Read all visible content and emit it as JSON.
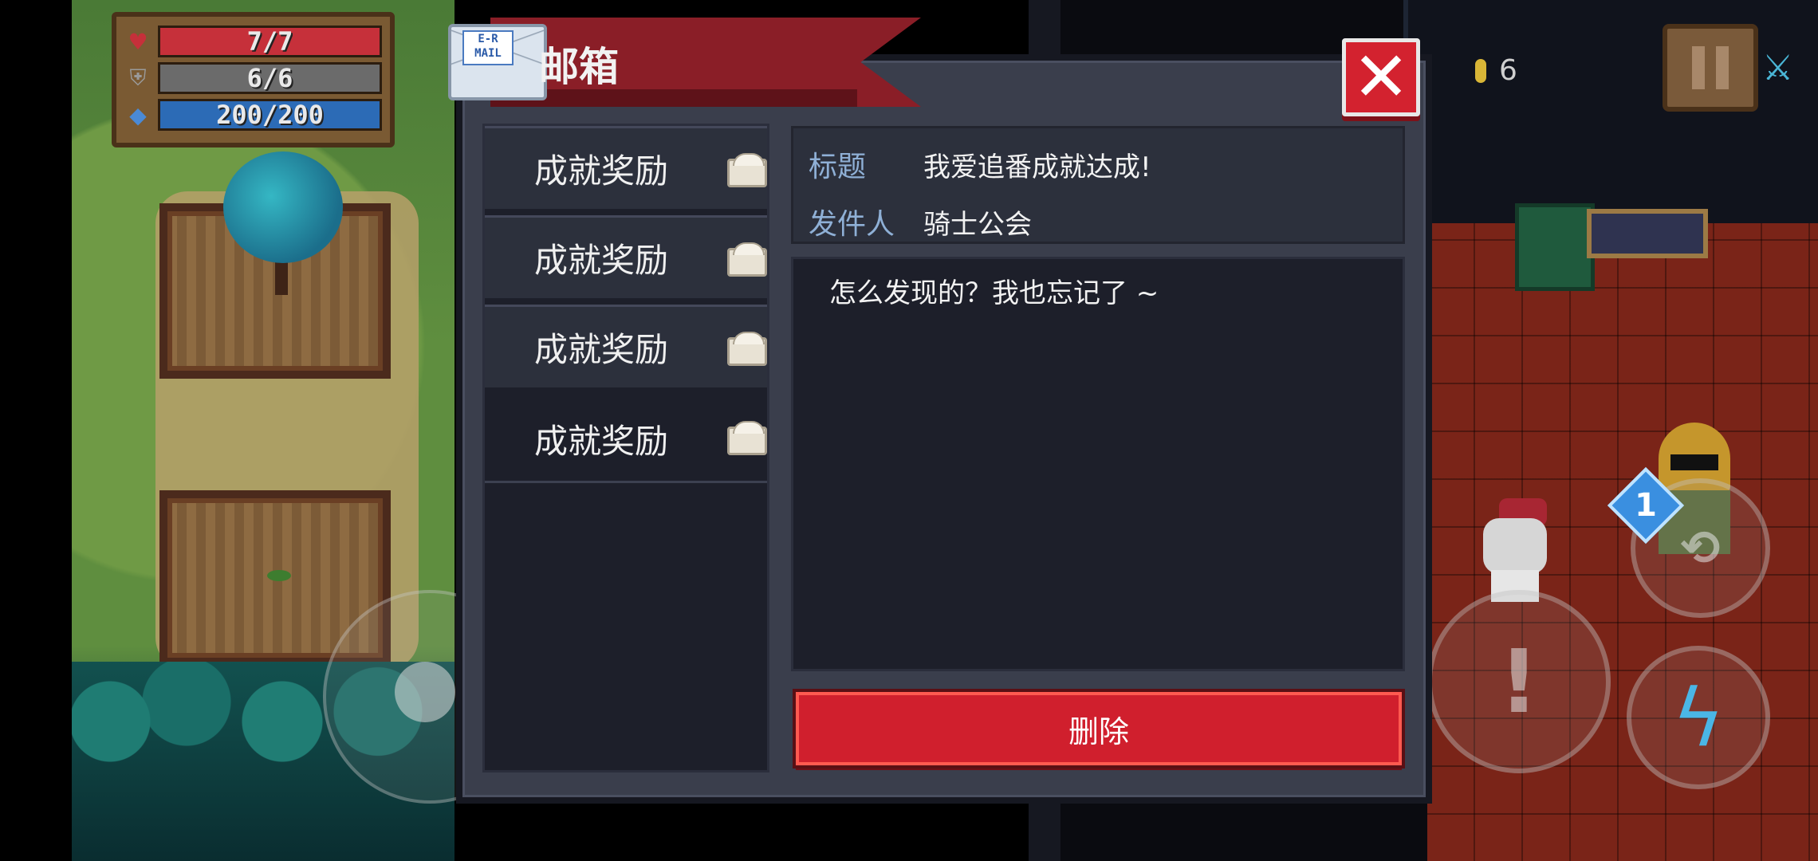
{
  "hud": {
    "hp": "7/7",
    "armor": "6/6",
    "energy": "200/200",
    "coins": "6",
    "colors": {
      "hp": "#c6303a",
      "armor": "#6b6b6b",
      "energy": "#2c6bb6"
    }
  },
  "mailbox": {
    "title": "邮箱",
    "mail_icon_text": "E-R MAIL",
    "list": [
      {
        "label": "成就奖励",
        "icon": "envelope-icon"
      },
      {
        "label": "成就奖励",
        "icon": "envelope-icon"
      },
      {
        "label": "成就奖励",
        "icon": "envelope-icon"
      },
      {
        "label": "成就奖励",
        "icon": "envelope-icon",
        "selected": true
      }
    ],
    "detail": {
      "subject_label": "标题",
      "subject": "我爱追番成就达成!",
      "sender_label": "发件人",
      "sender": "骑士公会",
      "body": "怎么发现的？我也忘记了 ~"
    },
    "delete_label": "删除",
    "accent_color": "#d01f2d"
  },
  "scene": {
    "badge": "1"
  }
}
